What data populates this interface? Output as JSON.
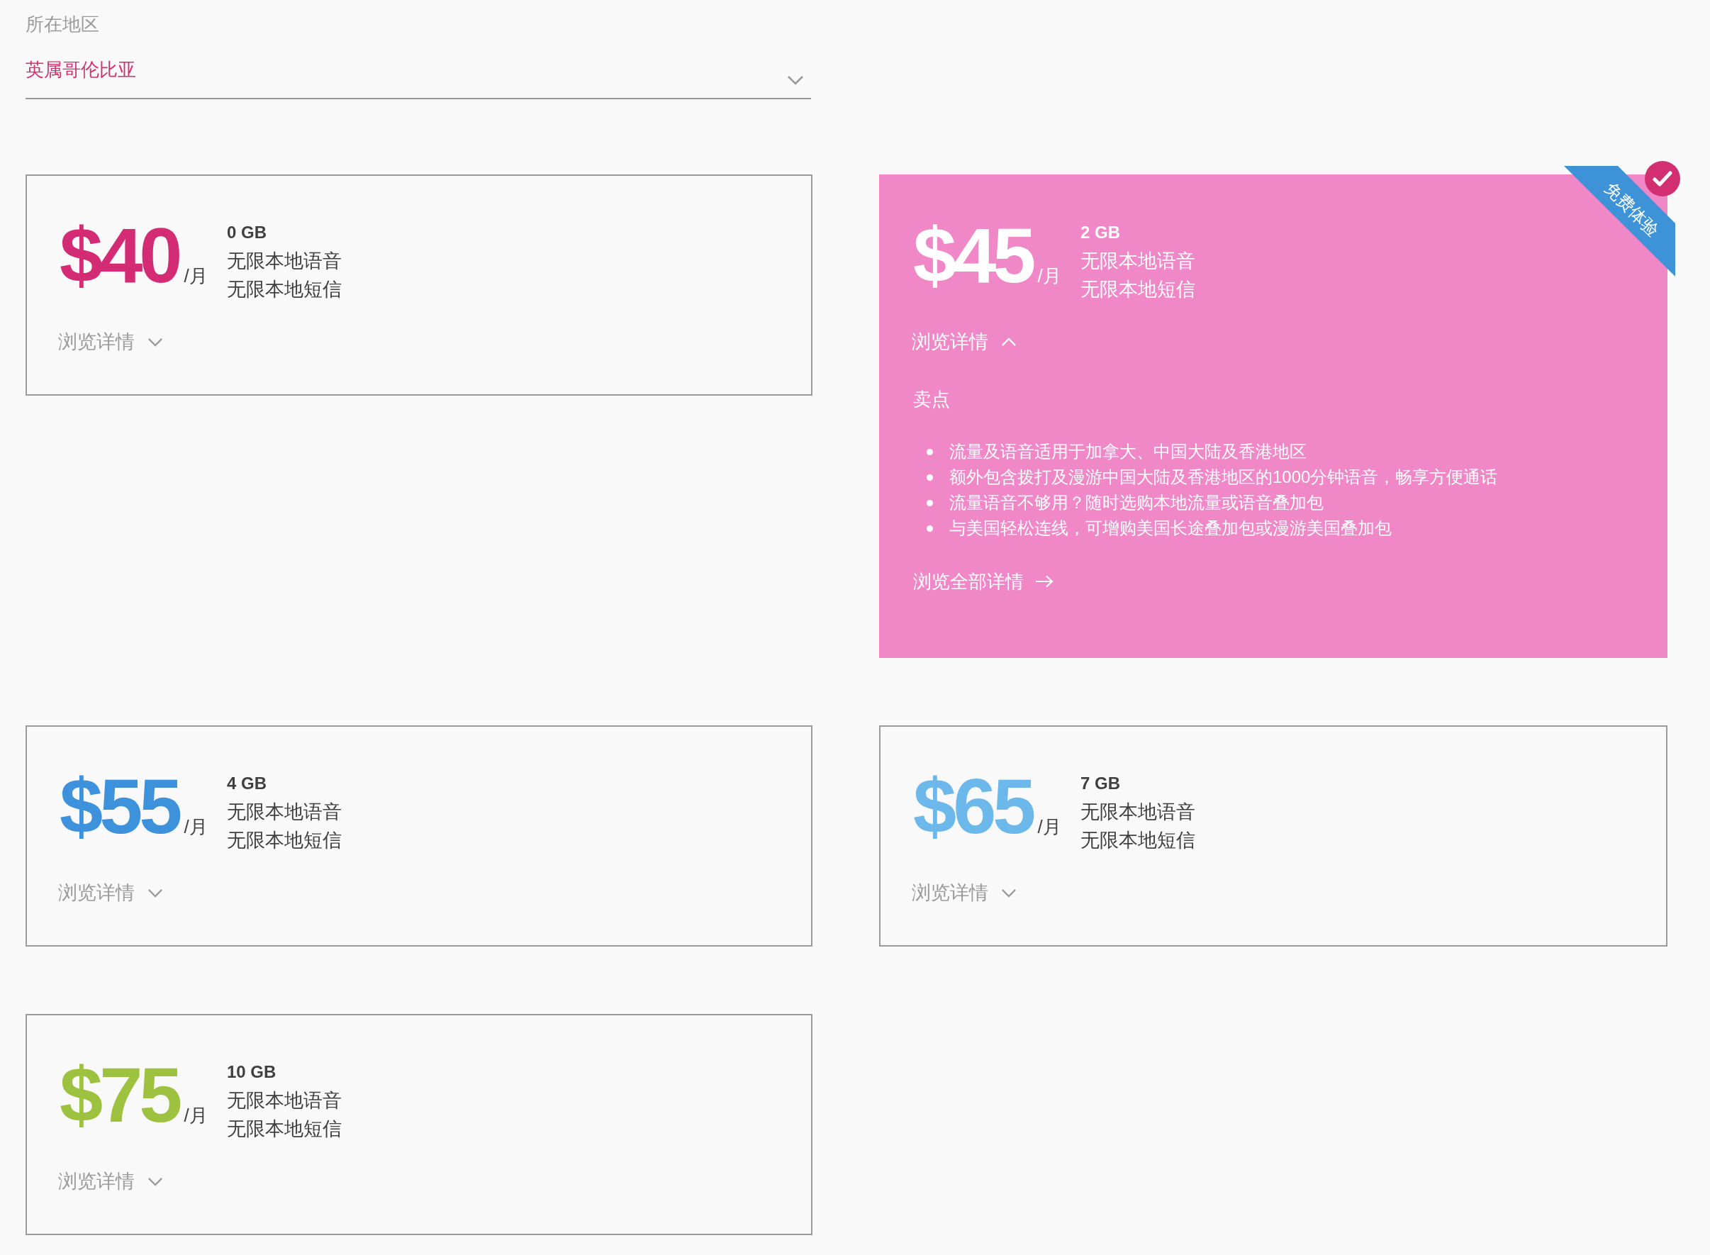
{
  "region": {
    "label": "所在地区",
    "value": "英属哥伦比亚"
  },
  "plans": [
    {
      "price": "$40",
      "period": "/月",
      "data": "0 GB",
      "features": [
        "无限本地语音",
        "无限本地短信"
      ],
      "toggle": "浏览详情",
      "color": "#d32c75",
      "selected": false,
      "expanded": false
    },
    {
      "price": "$45",
      "period": "/月",
      "data": "2 GB",
      "features": [
        "无限本地语音",
        "无限本地短信"
      ],
      "toggle": "浏览详情",
      "selected": true,
      "expanded": true,
      "badge": "免费体验",
      "details": {
        "heading": "卖点",
        "points": [
          "流量及语音适用于加拿大、中国大陆及香港地区",
          "额外包含拨打及漫游中国大陆及香港地区的1000分钟语音，畅享方便通话",
          "流量语音不够用？随时选购本地流量或语音叠加包",
          "与美国轻松连线，可增购美国长途叠加包或漫游美国叠加包"
        ],
        "link": "浏览全部详情"
      }
    },
    {
      "price": "$55",
      "period": "/月",
      "data": "4 GB",
      "features": [
        "无限本地语音",
        "无限本地短信"
      ],
      "toggle": "浏览详情",
      "color": "#3d92db",
      "selected": false,
      "expanded": false
    },
    {
      "price": "$65",
      "period": "/月",
      "data": "7 GB",
      "features": [
        "无限本地语音",
        "无限本地短信"
      ],
      "toggle": "浏览详情",
      "color": "#6cb8eb",
      "selected": false,
      "expanded": false
    },
    {
      "price": "$75",
      "period": "/月",
      "data": "10 GB",
      "features": [
        "无限本地语音",
        "无限本地短信"
      ],
      "toggle": "浏览详情",
      "color": "#9dc23f",
      "selected": false,
      "expanded": false
    }
  ]
}
